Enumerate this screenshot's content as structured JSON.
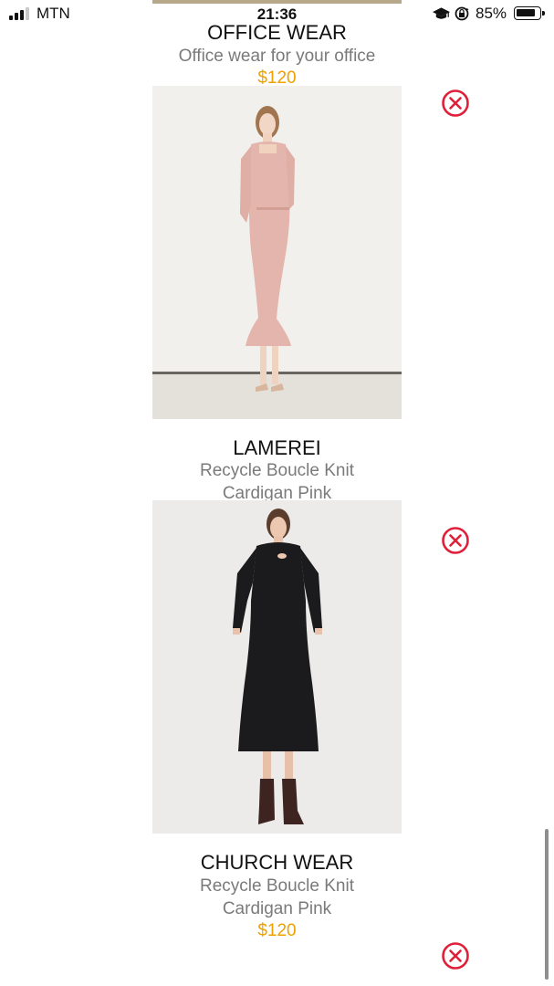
{
  "status_bar": {
    "carrier": "MTN",
    "time": "21:36",
    "battery_percent": "85%",
    "icons": [
      "signal-icon",
      "graduation-cap-icon",
      "rotation-lock-icon",
      "battery-icon"
    ]
  },
  "products": [
    {
      "title": "OFFICE WEAR",
      "description": "Office wear for your office",
      "price": "$120",
      "image": "pink-midi-dress-photo"
    },
    {
      "title": "LAMEREI",
      "description_lines": [
        "Recycle Boucle Knit",
        "Cardigan Pink"
      ],
      "image": "black-long-sleeve-dress-photo"
    },
    {
      "title": "CHURCH WEAR",
      "description_lines": [
        "Recycle Boucle Knit",
        "Cardigan Pink"
      ],
      "price": "$120"
    }
  ],
  "colors": {
    "price": "#f0a000",
    "remove_icon": "#e0203a",
    "description": "#7a7a7a"
  }
}
